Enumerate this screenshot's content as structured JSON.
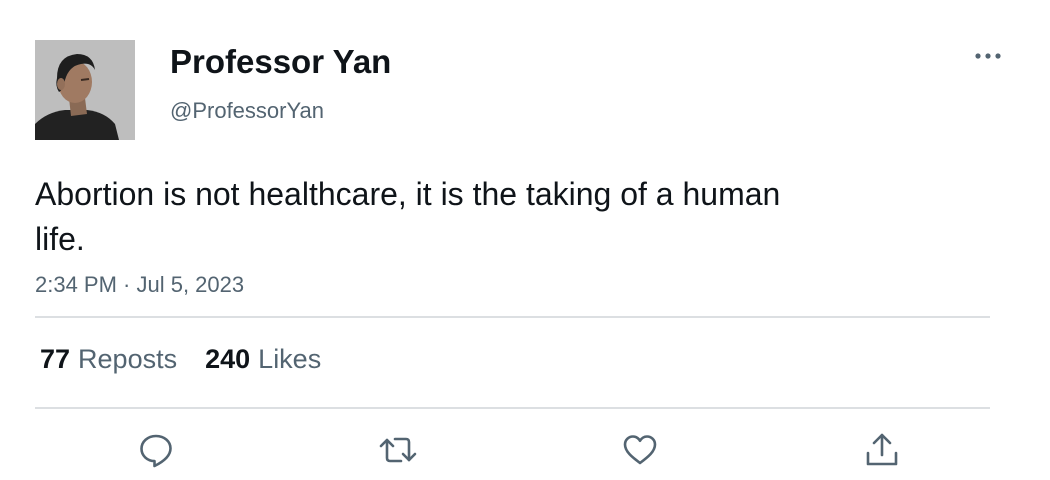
{
  "author": {
    "display_name": "Professor Yan",
    "handle": "@ProfessorYan",
    "avatar_icon": "profile-photo"
  },
  "tweet": {
    "text": "Abortion is not healthcare, it is the taking of a human life.",
    "timestamp": "2:34 PM · Jul 5, 2023"
  },
  "stats": {
    "reposts_count": "77",
    "reposts_label": "Reposts",
    "likes_count": "240",
    "likes_label": "Likes"
  },
  "actions": [
    {
      "name": "reply",
      "icon": "speech-bubble-icon"
    },
    {
      "name": "repost",
      "icon": "repost-arrows-icon"
    },
    {
      "name": "like",
      "icon": "heart-icon"
    },
    {
      "name": "share",
      "icon": "share-upload-icon"
    }
  ],
  "colors": {
    "primary_text": "#0f1419",
    "secondary_text": "#536471",
    "divider": "#dcdfe2",
    "icon": "#536471"
  }
}
